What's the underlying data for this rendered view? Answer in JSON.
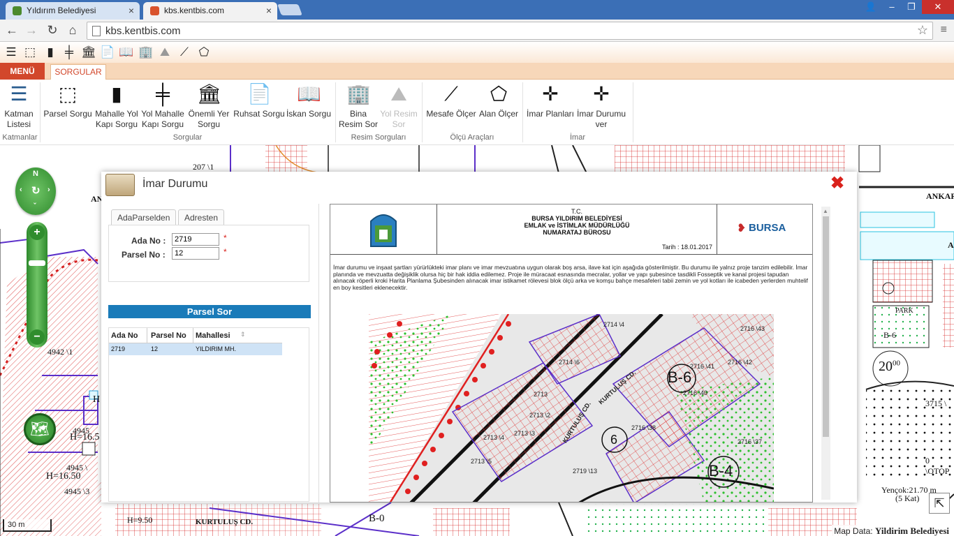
{
  "browser": {
    "tabs": [
      {
        "title": "Yıldırım Belediyesi",
        "active": false
      },
      {
        "title": "kbs.kentbis.com",
        "active": true
      }
    ],
    "url": "kbs.kentbis.com"
  },
  "ribbon_tabs": {
    "menu": "MENÜ",
    "sorgular": "SORGULAR"
  },
  "ribbon": {
    "katman": "Katman Listesi",
    "parsel": "Parsel Sorgu",
    "mahalle_yol": "Mahalle Yol Kapı Sorgu",
    "yol_mahalle": "Yol Mahalle Kapı Sorgu",
    "onemli_yer": "Önemli Yer Sorgu",
    "ruhsat": "Ruhsat Sorgu",
    "iskan": "İskan Sorgu",
    "bina_resim": "Bina Resim Sor",
    "yol_resim": "Yol Resim Sor",
    "mesafe": "Mesafe Ölçer",
    "alan": "Alan Ölçer",
    "imar_planlari": "İmar Planları",
    "imar_durumu": "İmar Durumu ver",
    "groups": {
      "katmanlar": "Katmanlar",
      "sorgular": "Sorgular",
      "resim": "Resim Sorguları",
      "olcu": "Ölçü Araçları",
      "imar": "İmar"
    }
  },
  "map": {
    "labels": {
      "ank": "AN",
      "ankar": "ANKAR",
      "a": "A",
      "p4942": "4942 \\1",
      "p4945": "4945 \\",
      "p4945b": "4945 \\3",
      "p4945c": "4945",
      "h1": "H=16.5",
      "h2": "H=16.50",
      "h3": "H=9.50",
      "hshort": "H",
      "kurtulus": "KURTULUŞ CD.",
      "b0": "B-0",
      "p207": "207 \\1",
      "twenty": "20",
      "superscript": "00",
      "p3715": "3715 \\",
      "otop": "0 \\OTOP",
      "yencok": "Yençok:21.70 m",
      "kat": "(5 Kat)",
      "park": "PARK",
      "b6": "B-6"
    },
    "scale": "30 m",
    "attribution_prefix": "Map Data:",
    "attribution_name": "Yildirim Belediyesi"
  },
  "dialog": {
    "title": "İmar Durumu",
    "tabs": [
      "AdaParselden",
      "Adresten"
    ],
    "ada_label": "Ada No :",
    "ada_value": "2719",
    "parsel_label": "Parsel No :",
    "parsel_value": "12",
    "required": "*",
    "button": "Parsel Sor",
    "grid": {
      "headers": [
        "Ada No",
        "Parsel No",
        "Mahallesi"
      ],
      "rows": [
        {
          "ada": "2719",
          "parsel": "12",
          "mahalle": "YILDIRIM MH."
        }
      ]
    }
  },
  "document": {
    "tc": "T.C.",
    "line1": "BURSA YILDIRIM BELEDİYESİ",
    "line2": "EMLAK ve İSTİMLAK MÜDÜRLÜĞÜ",
    "line3": "NUMARATAJ BÜROSU",
    "date": "Tarih : 18.01.2017",
    "bursa_logo": "BURSA",
    "text": "İmar durumu ve inşaat şartları yürürlükteki imar planı ve imar mevzuatına uygun olarak boş arsa, ilave kat için aşağıda gösterilmiştir. Bu durumu ile yalnız proje tanzim edilebilir. İmar planında ve mevzuatta değişiklik olursa hiç bir hak iddia edilemez. Proje ile müracaat esnasında mecralar, yollar ve yapı şubesince tasdikli Fosseptik ve kanal projesi tapudan alınacak röperli kroki Harita Planlama Şubesinden alınacak imar istikamet rölevesi blok ölçü arka ve komşu bahçe mesafeleri tabii zemin ve yol kotları ile icabeden yerlerden muhtelif en boy kesitleri eklenecektir.",
    "map_labels": {
      "b6": "B-6",
      "b4": "B-4",
      "six": "6",
      "kurtulus1": "KURTULUŞ CD.",
      "kurtulus2": "KURTULUŞ CD.",
      "p1": "2713",
      "p2": "2713 \\2",
      "p3": "2713 \\3",
      "p4": "2713 \\4",
      "p5": "2713 \\5",
      "p6": "2714 \\6",
      "p7": "2716 \\38",
      "p8": "2716 \\37",
      "p9": "2716 \\40",
      "p10": "2716 \\41",
      "p11": "2716 \\42",
      "p12": "2716 \\43",
      "p13": "2719 \\13",
      "p14": "2714 \\4"
    }
  },
  "colors": {
    "accent_red": "#d2472b",
    "ribbon_bg": "#f7d7b9",
    "button_blue": "#1a7bb9",
    "map_green": "#2e8a2c",
    "close_red": "#d9221c"
  }
}
